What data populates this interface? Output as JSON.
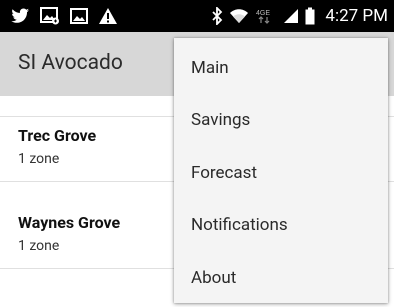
{
  "status_bar": {
    "left_icons": [
      "twitter-icon",
      "image-notification-icon",
      "gallery-icon",
      "warning-icon"
    ],
    "right_icons": [
      "bluetooth-icon",
      "wifi-icon",
      "lte-icon",
      "signal-icon",
      "battery-icon"
    ],
    "network_label": "4GE",
    "time": "4:27 PM"
  },
  "app_bar": {
    "title": "SI Avocado"
  },
  "list": {
    "items": [
      {
        "title": "Trec Grove",
        "subtitle": "1 zone"
      },
      {
        "title": "Waynes Grove",
        "subtitle": "1 zone"
      }
    ]
  },
  "overflow_menu": {
    "items": [
      {
        "label": "Main"
      },
      {
        "label": "Savings"
      },
      {
        "label": "Forecast"
      },
      {
        "label": "Notifications"
      },
      {
        "label": "About"
      }
    ]
  }
}
